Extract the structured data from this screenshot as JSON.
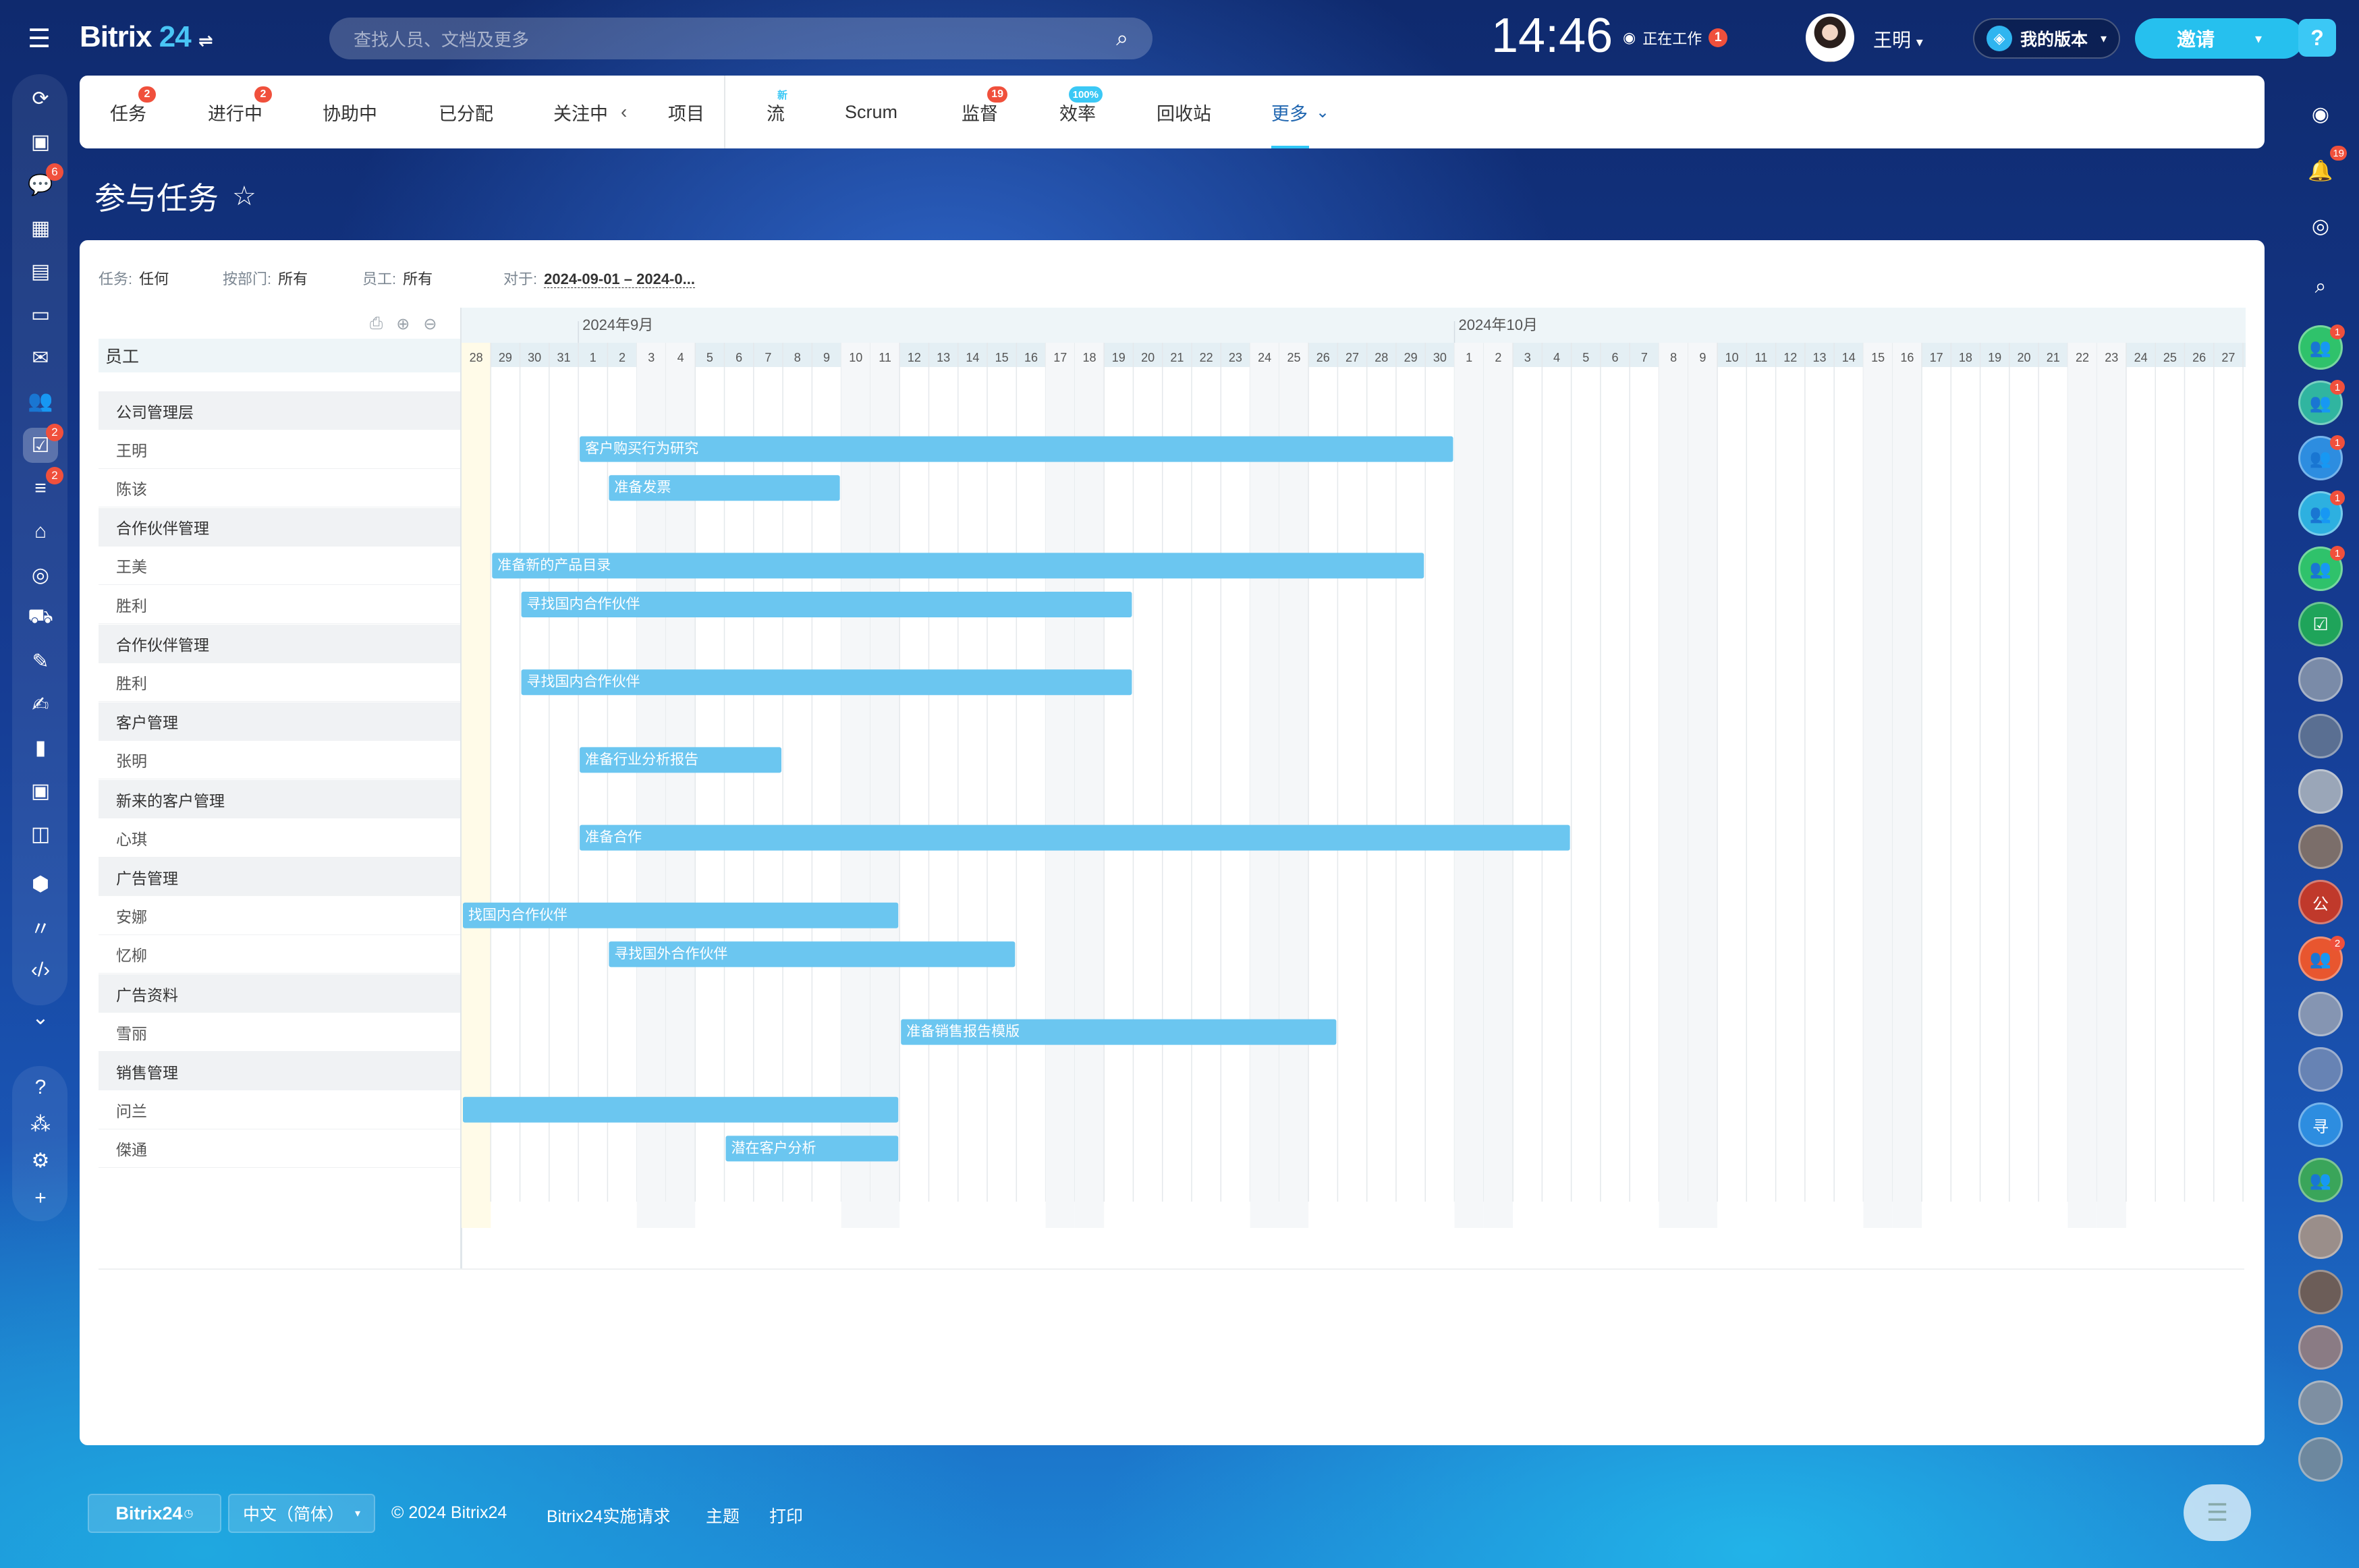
{
  "app": {
    "name": "Bitrix",
    "name_num": "24",
    "search_placeholder": "查找人员、文档及更多",
    "clock": "14:46",
    "work_status": "正在工作",
    "work_badge": "1",
    "user_name": "王明",
    "my_version": "我的版本",
    "invite": "邀请",
    "help": "?"
  },
  "left_nav": {
    "icons": [
      {
        "name": "feed-icon",
        "glyph": "⟳"
      },
      {
        "name": "news-icon",
        "glyph": "▣"
      },
      {
        "name": "messenger-icon",
        "glyph": "💬",
        "badge": "6"
      },
      {
        "name": "calendar-icon",
        "glyph": "▦"
      },
      {
        "name": "docs-icon",
        "glyph": "▤"
      },
      {
        "name": "drive-icon",
        "glyph": "▭"
      },
      {
        "name": "mail-icon",
        "glyph": "✉"
      },
      {
        "name": "employees-icon",
        "glyph": "👥"
      },
      {
        "name": "tasks-icon",
        "glyph": "☑",
        "badge": "2"
      },
      {
        "name": "crm-icon",
        "glyph": "≡",
        "badge": "2"
      },
      {
        "name": "bank-icon",
        "glyph": "⌂"
      },
      {
        "name": "target-icon",
        "glyph": "◎"
      },
      {
        "name": "cart-icon",
        "glyph": "⛟"
      },
      {
        "name": "invoice-icon",
        "glyph": "✎"
      },
      {
        "name": "sign-icon",
        "glyph": "✍"
      },
      {
        "name": "analytics-icon",
        "glyph": "▮"
      },
      {
        "name": "contact-center-icon",
        "glyph": "▣"
      },
      {
        "name": "robot-icon",
        "glyph": "◫"
      },
      {
        "name": "box-icon",
        "glyph": "⬢"
      },
      {
        "name": "automation-icon",
        "glyph": "〃"
      },
      {
        "name": "developer-icon",
        "glyph": "‹/›"
      },
      {
        "name": "more-down-icon",
        "glyph": "⌄"
      },
      {
        "name": "help-icon",
        "glyph": "?"
      },
      {
        "name": "structure-icon",
        "glyph": "⁂"
      },
      {
        "name": "settings-icon",
        "glyph": "⚙"
      },
      {
        "name": "add-icon",
        "glyph": "+"
      }
    ]
  },
  "tabs": [
    {
      "label": "任务",
      "badge": "2"
    },
    {
      "label": "进行中",
      "badge": "2"
    },
    {
      "label": "协助中"
    },
    {
      "label": "已分配"
    },
    {
      "label": "关注中"
    },
    {
      "label": "项目"
    },
    {
      "label": "流",
      "tag": "新"
    },
    {
      "label": "Scrum"
    },
    {
      "label": "监督",
      "badge": "19"
    },
    {
      "label": "效率",
      "tag": "100%"
    },
    {
      "label": "回收站"
    },
    {
      "label": "更多"
    }
  ],
  "page_title": "参与任务",
  "filters": [
    {
      "label": "任务:",
      "value": "任何"
    },
    {
      "label": "按部门:",
      "value": "所有"
    },
    {
      "label": "员工:",
      "value": "所有"
    },
    {
      "label": "对于:",
      "value": "2024-09-01 – 2024-0..."
    }
  ],
  "gantt": {
    "column_header": "员工",
    "months": [
      "2024年9月",
      "2024年10月"
    ],
    "days": [
      "28",
      "29",
      "30",
      "31",
      "1",
      "2",
      "3",
      "4",
      "5",
      "6",
      "7",
      "8",
      "9",
      "10",
      "11",
      "12",
      "13",
      "14",
      "15",
      "16",
      "17",
      "18",
      "19",
      "20",
      "21",
      "22",
      "23",
      "24",
      "25",
      "26",
      "27",
      "28",
      "29",
      "30",
      "1",
      "2",
      "3",
      "4",
      "5",
      "6",
      "7",
      "8",
      "9",
      "10",
      "11",
      "12",
      "13",
      "14",
      "15",
      "16",
      "17",
      "18",
      "19",
      "20",
      "21",
      "22",
      "23",
      "24",
      "25",
      "26",
      "27"
    ],
    "weekend_day_indices": [
      0,
      6,
      7,
      13,
      14,
      20,
      21,
      27,
      28,
      34,
      35,
      41,
      42,
      48,
      49,
      55,
      56
    ],
    "rows": [
      {
        "type": "group",
        "label": "公司管理层"
      },
      {
        "type": "user",
        "label": "王明",
        "task": "客户购买行为研究",
        "start": "2024-09-01",
        "end": "2024-09-30"
      },
      {
        "type": "user",
        "label": "陈该",
        "task": "准备发票",
        "start": "2024-09-02",
        "end": "2024-09-09"
      },
      {
        "type": "group",
        "label": "合作伙伴管理"
      },
      {
        "type": "user",
        "label": "王美",
        "task": "准备新的产品目录",
        "start": "2024-08-29",
        "end": "2024-09-29"
      },
      {
        "type": "user",
        "label": "胜利",
        "task": "寻找国内合作伙伴",
        "start": "2024-08-30",
        "end": "2024-09-19"
      },
      {
        "type": "group",
        "label": "合作伙伴管理"
      },
      {
        "type": "user",
        "label": "胜利",
        "task": "寻找国内合作伙伴",
        "start": "2024-08-30",
        "end": "2024-09-19"
      },
      {
        "type": "group",
        "label": "客户管理"
      },
      {
        "type": "user",
        "label": "张明",
        "task": "准备行业分析报告",
        "start": "2024-09-01",
        "end": "2024-09-07"
      },
      {
        "type": "group",
        "label": "新来的客户管理"
      },
      {
        "type": "user",
        "label": "心琪",
        "task": "准备合作",
        "start": "2024-09-01",
        "end": "2024-10-04"
      },
      {
        "type": "group",
        "label": "广告管理"
      },
      {
        "type": "user",
        "label": "安娜",
        "task": "找国内合作伙伴",
        "start": "2024-08-28",
        "end": "2024-09-11"
      },
      {
        "type": "user",
        "label": "忆柳",
        "task": "寻找国外合作伙伴",
        "start": "2024-09-02",
        "end": "2024-09-15"
      },
      {
        "type": "group",
        "label": "广告资料"
      },
      {
        "type": "user",
        "label": "雪丽",
        "task": "准备销售报告模版",
        "start": "2024-09-12",
        "end": "2024-09-26"
      },
      {
        "type": "group",
        "label": "销售管理"
      },
      {
        "type": "user",
        "label": "问兰",
        "task": "",
        "start": "2024-08-28",
        "end": "2024-09-11"
      },
      {
        "type": "user",
        "label": "傑通",
        "task": "潜在客户分析",
        "start": "2024-09-06",
        "end": "2024-09-11"
      }
    ]
  },
  "footer": {
    "brand": "Bitrix24",
    "language": "中文（简体）",
    "copyright": "© 2024 Bitrix24",
    "implementation": "Bitrix24实施请求",
    "theme": "主题",
    "print": "打印"
  },
  "right_bar": {
    "items": [
      {
        "name": "copilot-icon",
        "glyph": "◉"
      },
      {
        "name": "notifications-icon",
        "glyph": "🔔",
        "badge": "19"
      },
      {
        "name": "chat-search-icon",
        "glyph": "◎"
      },
      {
        "name": "search-icon",
        "glyph": "⌕"
      },
      {
        "name": "group-chat-avatar",
        "color": "#2fc26b",
        "badge": "1"
      },
      {
        "name": "group-chat-avatar",
        "color": "#30b5a0",
        "badge": "1"
      },
      {
        "name": "group-chat-avatar",
        "color": "#2d8de0",
        "badge": "1"
      },
      {
        "name": "group-chat-avatar",
        "color": "#2db0e0",
        "badge": "1"
      },
      {
        "name": "group-chat-avatar",
        "color": "#2fc26b",
        "badge": "1"
      },
      {
        "name": "task-chat-avatar",
        "color": "#1fa45a"
      },
      {
        "name": "photo-avatar",
        "color": "#7a8ba8"
      },
      {
        "name": "photo-avatar",
        "color": "#5a6f92"
      },
      {
        "name": "photo-avatar",
        "color": "#9aa6b8"
      },
      {
        "name": "photo-avatar",
        "color": "#7b6e6a"
      },
      {
        "name": "letter-avatar",
        "color": "#c0392b",
        "letter": "公"
      },
      {
        "name": "group-chat-avatar",
        "color": "#e8562f",
        "badge": "2"
      },
      {
        "name": "photo-avatar",
        "color": "#8595b2"
      },
      {
        "name": "photo-avatar",
        "color": "#6783b4"
      },
      {
        "name": "letter-avatar",
        "color": "#2d8de0",
        "letter": "寻"
      },
      {
        "name": "group-chat-avatar",
        "color": "#3aa55a"
      },
      {
        "name": "photo-avatar",
        "color": "#9a8e8a"
      },
      {
        "name": "photo-avatar",
        "color": "#6c5d58"
      },
      {
        "name": "photo-avatar",
        "color": "#8a7b84"
      },
      {
        "name": "photo-avatar",
        "color": "#7e8fa2"
      },
      {
        "name": "photo-avatar",
        "color": "#6e889e"
      }
    ]
  }
}
